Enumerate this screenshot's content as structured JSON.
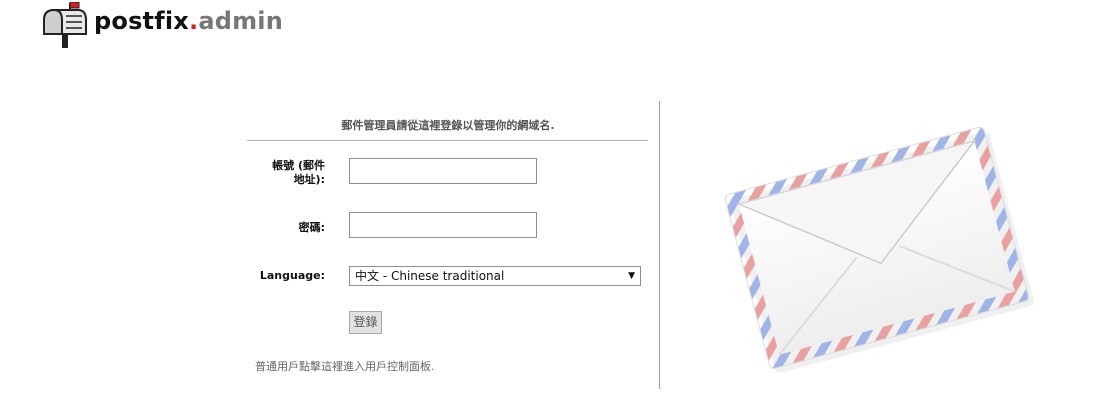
{
  "header": {
    "logo_part1": "postfix",
    "logo_dot": ".",
    "logo_part2": "admin"
  },
  "login": {
    "heading": "郵件管理員請從這裡登錄以管理你的網域名.",
    "username_label_line1": "帳號 (郵件",
    "username_label_line2": "地址):",
    "username_value": "",
    "password_label": "密碼:",
    "password_value": "",
    "language_label": "Language:",
    "language_selected": "中文 - Chinese traditional",
    "submit_label": "登錄",
    "user_login_note": "普通用戶點擊這裡進入用戶控制面板."
  },
  "icons": {
    "logo": "mailbox-icon",
    "dropdown": "chevron-down-icon",
    "illustration": "envelope-icon"
  },
  "colors": {
    "logo_accent": "#d42020",
    "logo_gray": "#777777",
    "airmail_red": "#e8a0a0",
    "airmail_blue": "#a0b4e8"
  }
}
